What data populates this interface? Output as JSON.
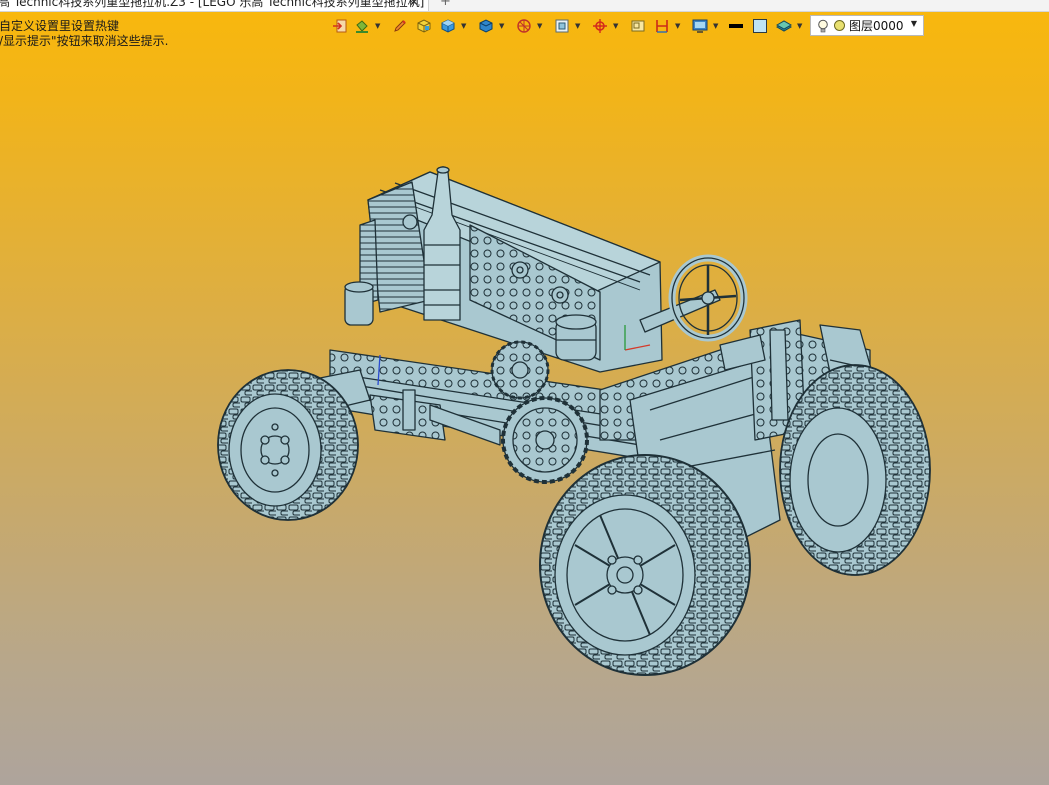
{
  "tab": {
    "title": "高 Technic科技系列重型拖拉机.Z3 - [LEGO 乐高 Technic科技系列重型拖拉机]",
    "close_symbol": "✕",
    "add_symbol": "+"
  },
  "hints": {
    "line1": "自定义设置里设置热键",
    "line2": "/显示提示\"按钮来取消这些提示."
  },
  "toolbar": {
    "icons": [
      "exit-sketch-icon",
      "paint-bucket-icon",
      "pencil-icon",
      "box-solid-icon",
      "shaded-cube-icon",
      "display-mode-icon",
      "section-view-icon",
      "zoom-window-icon",
      "datum-plane-icon",
      "frame-icon",
      "dimension-icon",
      "monitor-icon",
      "line-color-icon",
      "fill-color-icon",
      "layer-stack-icon"
    ],
    "layer_selector": {
      "value": "图层0000"
    }
  },
  "colors": {
    "viewport_top": "#f9b80c",
    "viewport_bottom": "#aea49c",
    "model_fill": "#a9c8d0",
    "model_edge": "#1f3138"
  }
}
